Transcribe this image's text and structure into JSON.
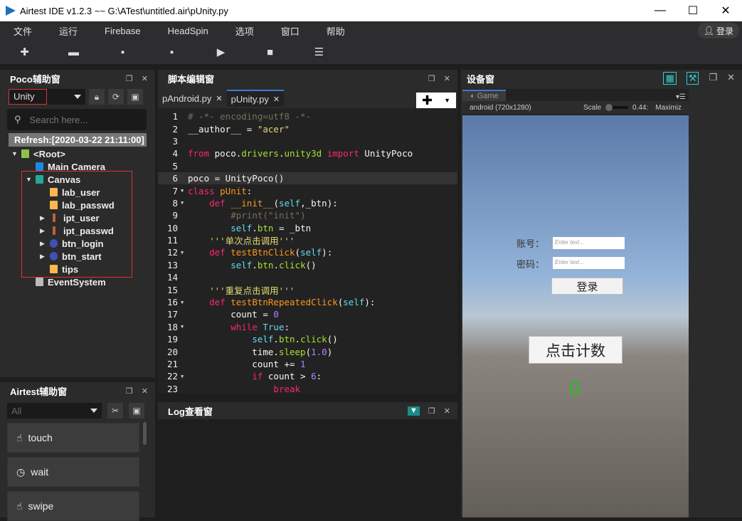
{
  "window": {
    "title": "Airtest IDE v1.2.3 ~~ G:\\ATest\\untitled.air\\pUnity.py",
    "minimize": "—",
    "maximize": "☐",
    "close": "✕"
  },
  "menu": [
    "文件",
    "运行",
    "Firebase",
    "HeadSpin",
    "选项",
    "窗口",
    "帮助"
  ],
  "login_label": "登录",
  "toolbar": [
    {
      "icon": "plus-icon",
      "g": "✚"
    },
    {
      "icon": "folder-open-icon",
      "g": "▬"
    },
    {
      "icon": "save-icon",
      "g": "▪"
    },
    {
      "icon": "save-as-icon",
      "g": "▪"
    },
    {
      "icon": "play-icon",
      "g": "▶"
    },
    {
      "icon": "stop-icon",
      "g": "■"
    },
    {
      "icon": "log-icon",
      "g": "☰"
    }
  ],
  "poco": {
    "title": "Poco辅助窗",
    "mode": "Unity",
    "search_placeholder": "Search here...",
    "refresh": "Refresh:[2020-03-22 21:11:00]",
    "tree": [
      {
        "label": "<Root>",
        "depth": 0,
        "toggle": "▼",
        "icon": "root-icon",
        "color": "#8bc34a"
      },
      {
        "label": "Main Camera",
        "depth": 1,
        "toggle": "",
        "icon": "camera-icon",
        "color": "#1e88e5"
      },
      {
        "label": "Canvas",
        "depth": 1,
        "toggle": "▼",
        "icon": "canvas-icon",
        "color": "#26a69a"
      },
      {
        "label": "lab_user",
        "depth": 2,
        "toggle": "",
        "icon": "text-icon",
        "color": "#ffb74d"
      },
      {
        "label": "lab_passwd",
        "depth": 2,
        "toggle": "",
        "icon": "text-icon",
        "color": "#ffb74d"
      },
      {
        "label": "ipt_user",
        "depth": 2,
        "toggle": "▶",
        "icon": "input-icon",
        "color": "#c0603a"
      },
      {
        "label": "ipt_passwd",
        "depth": 2,
        "toggle": "▶",
        "icon": "input-icon",
        "color": "#c0603a"
      },
      {
        "label": "btn_login",
        "depth": 2,
        "toggle": "▶",
        "icon": "button-icon",
        "color": "#3f51b5"
      },
      {
        "label": "btn_start",
        "depth": 2,
        "toggle": "▶",
        "icon": "button-icon",
        "color": "#3f51b5"
      },
      {
        "label": "tips",
        "depth": 2,
        "toggle": "",
        "icon": "text-icon",
        "color": "#ffb74d"
      },
      {
        "label": "EventSystem",
        "depth": 1,
        "toggle": "",
        "icon": "home-icon",
        "color": "#bbb"
      }
    ]
  },
  "airtest": {
    "title": "Airtest辅助窗",
    "filter": "All",
    "actions": [
      {
        "label": "touch",
        "icon": "touch-icon",
        "g": "☝"
      },
      {
        "label": "wait",
        "icon": "clock-icon",
        "g": "◷"
      },
      {
        "label": "swipe",
        "icon": "swipe-icon",
        "g": "☝"
      }
    ]
  },
  "editor": {
    "title": "脚本编辑窗",
    "tabs": [
      "pAndroid.py",
      "pUnity.py"
    ],
    "active_tab": 1,
    "lines": [
      [
        [
          "c",
          "# -*- encoding=utf8 -*-"
        ]
      ],
      [
        [
          "p",
          "__author__ = "
        ],
        [
          "s",
          "\"acer\""
        ]
      ],
      [],
      [
        [
          "k",
          "from "
        ],
        [
          "p",
          "poco."
        ],
        [
          "a",
          "drivers"
        ],
        [
          "p",
          "."
        ],
        [
          "a",
          "unity3d "
        ],
        [
          "k",
          "import "
        ],
        [
          "p",
          "UnityPoco"
        ]
      ],
      [],
      [
        [
          "p",
          "poco = UnityPoco()"
        ]
      ],
      [
        [
          "k",
          "class "
        ],
        [
          "f",
          "pUnit"
        ],
        [
          "p",
          ":"
        ]
      ],
      [
        [
          "p",
          "    "
        ],
        [
          "k",
          "def "
        ],
        [
          "f",
          "__init__"
        ],
        [
          "p",
          "("
        ],
        [
          "sf",
          "self"
        ],
        [
          "p",
          ",_btn):"
        ]
      ],
      [
        [
          "p",
          "        "
        ],
        [
          "c",
          "#print(\"init\")"
        ]
      ],
      [
        [
          "p",
          "        "
        ],
        [
          "sf",
          "self"
        ],
        [
          "p",
          "."
        ],
        [
          "a",
          "btn"
        ],
        [
          "p",
          " = _btn"
        ]
      ],
      [
        [
          "p",
          "    "
        ],
        [
          "s",
          "'''单次点击调用'''"
        ]
      ],
      [
        [
          "p",
          "    "
        ],
        [
          "k",
          "def "
        ],
        [
          "f",
          "testBtnClick"
        ],
        [
          "p",
          "("
        ],
        [
          "sf",
          "self"
        ],
        [
          "p",
          "):"
        ]
      ],
      [
        [
          "p",
          "        "
        ],
        [
          "sf",
          "self"
        ],
        [
          "p",
          "."
        ],
        [
          "a",
          "btn"
        ],
        [
          "p",
          "."
        ],
        [
          "a",
          "click"
        ],
        [
          "p",
          "()"
        ]
      ],
      [],
      [
        [
          "p",
          "    "
        ],
        [
          "s",
          "'''重复点击调用'''"
        ]
      ],
      [
        [
          "p",
          "    "
        ],
        [
          "k",
          "def "
        ],
        [
          "f",
          "testBtnRepeatedClick"
        ],
        [
          "p",
          "("
        ],
        [
          "sf",
          "self"
        ],
        [
          "p",
          "):"
        ]
      ],
      [
        [
          "p",
          "        count = "
        ],
        [
          "n",
          "0"
        ]
      ],
      [
        [
          "p",
          "        "
        ],
        [
          "k",
          "while "
        ],
        [
          "sf",
          "True"
        ],
        [
          "p",
          ":"
        ]
      ],
      [
        [
          "p",
          "            "
        ],
        [
          "sf",
          "self"
        ],
        [
          "p",
          "."
        ],
        [
          "a",
          "btn"
        ],
        [
          "p",
          "."
        ],
        [
          "a",
          "click"
        ],
        [
          "p",
          "()"
        ]
      ],
      [
        [
          "p",
          "            time."
        ],
        [
          "a",
          "sleep"
        ],
        [
          "p",
          "("
        ],
        [
          "n",
          "1.0"
        ],
        [
          "p",
          ")"
        ]
      ],
      [
        [
          "p",
          "            count += "
        ],
        [
          "n",
          "1"
        ]
      ],
      [
        [
          "p",
          "            "
        ],
        [
          "k",
          "if "
        ],
        [
          "p",
          "count > "
        ],
        [
          "n",
          "6"
        ],
        [
          "p",
          ":"
        ]
      ],
      [
        [
          "p",
          "                "
        ],
        [
          "k",
          "break"
        ]
      ]
    ],
    "folds": [
      7,
      8,
      12,
      16,
      18,
      22
    ],
    "current_line": 6
  },
  "log": {
    "title": "Log查看窗"
  },
  "device": {
    "title": "设备窗",
    "game_tab": "Game",
    "resolution": "android (720x1280)",
    "scale_label": "Scale",
    "scale_value": "0.44:",
    "maximize": "Maximiz",
    "game": {
      "account_label": "账号：",
      "password_label": "密码：",
      "input_placeholder": "Enter text...",
      "login_button": "登录",
      "start_button": "点击计数",
      "count": "0",
      "count_color": "#22c022"
    }
  }
}
